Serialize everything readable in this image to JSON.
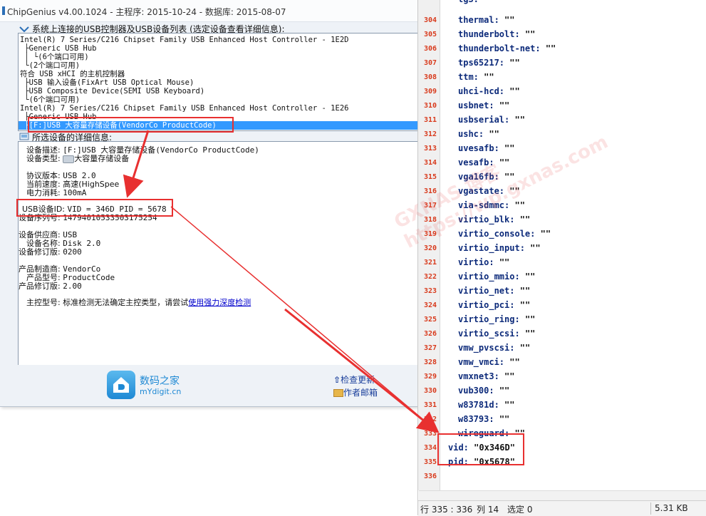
{
  "chipgenius": {
    "title": "ChipGenius v4.00.1024 - 主程序: 2015-10-24 - 数据库: 2015-08-07",
    "device_list_header": "系统上连接的USB控制器及USB设备列表 (选定设备查看详细信息):",
    "tree": [
      "Intel(R) 7 Series/C216 Chipset Family USB Enhanced Host Controller - 1E2D",
      " ├Generic USB Hub",
      " │ └(6个端口可用)",
      " └(2个端口可用)",
      "符合 USB xHCI 的主机控制器",
      " ├USB 输入设备(FixArt USB Optical Mouse)",
      " ├USB Composite Device(SEMI USB Keyboard)",
      " └(6个端口可用)",
      "Intel(R) 7 Series/C216 Chipset Family USB Enhanced Host Controller - 1E26",
      " ├Generic USB Hub",
      " ├[F:]USB 大容量存储设备(VendorCo ProductCode)"
    ],
    "detail_header": "所选设备的详细信息:",
    "details": {
      "desc_label": "设备描述:",
      "desc_value": "[F:]USB 大容量存储设备(VendorCo ProductCode)",
      "type_label": "设备类型:",
      "type_value": "大容量存储设备",
      "proto_label": "协议版本:",
      "proto_value": "USB 2.0",
      "speed_label": "当前速度:",
      "speed_value": "高速(HighSpee",
      "power_label": "电力消耗:",
      "power_value": "100mA",
      "id_label": "USB设备ID:",
      "id_value": "VID = 346D PID = 5678",
      "serial_label": "设备序列号:",
      "serial_value": "14794010533503175254",
      "vendor_label": "设备供应商:",
      "vendor_value": "USB",
      "name_label": "设备名称:",
      "name_value": "Disk 2.0",
      "rev_label": "设备修订版:",
      "rev_value": "0200",
      "mfr_label": "产品制造商:",
      "mfr_value": "VendorCo",
      "model_label": "产品型号:",
      "model_value": "ProductCode",
      "prev_label": "产品修订版:",
      "prev_value": "2.00",
      "ctrl_label": "主控型号:",
      "ctrl_value": "标准检测无法确定主控类型，请尝试",
      "ctrl_link": "使用强力深度检测"
    },
    "footer": {
      "logo_cn": "数码之家",
      "logo_en": "mYdigit.cn",
      "check_update": "检查更新",
      "author_email": "作者邮箱"
    }
  },
  "editor": {
    "lines": [
      {
        "n": "",
        "key": "tg3:",
        "val": ""
      },
      {
        "n": "304",
        "key": "thermal:",
        "val": "\"\""
      },
      {
        "n": "305",
        "key": "thunderbolt:",
        "val": "\"\""
      },
      {
        "n": "306",
        "key": "thunderbolt-net:",
        "val": "\"\""
      },
      {
        "n": "307",
        "key": "tps65217:",
        "val": "\"\""
      },
      {
        "n": "308",
        "key": "ttm:",
        "val": "\"\""
      },
      {
        "n": "309",
        "key": "uhci-hcd:",
        "val": "\"\""
      },
      {
        "n": "310",
        "key": "usbnet:",
        "val": "\"\""
      },
      {
        "n": "311",
        "key": "usbserial:",
        "val": "\"\""
      },
      {
        "n": "312",
        "key": "ushc:",
        "val": "\"\""
      },
      {
        "n": "313",
        "key": "uvesafb:",
        "val": "\"\""
      },
      {
        "n": "314",
        "key": "vesafb:",
        "val": "\"\""
      },
      {
        "n": "315",
        "key": "vga16fb:",
        "val": "\"\""
      },
      {
        "n": "316",
        "key": "vgastate:",
        "val": "\"\""
      },
      {
        "n": "317",
        "key": "via-sdmmc:",
        "val": "\"\""
      },
      {
        "n": "318",
        "key": "virtio_blk:",
        "val": "\"\""
      },
      {
        "n": "319",
        "key": "virtio_console:",
        "val": "\"\""
      },
      {
        "n": "320",
        "key": "virtio_input:",
        "val": "\"\""
      },
      {
        "n": "321",
        "key": "virtio:",
        "val": "\"\""
      },
      {
        "n": "322",
        "key": "virtio_mmio:",
        "val": "\"\""
      },
      {
        "n": "323",
        "key": "virtio_net:",
        "val": "\"\""
      },
      {
        "n": "324",
        "key": "virtio_pci:",
        "val": "\"\""
      },
      {
        "n": "325",
        "key": "virtio_ring:",
        "val": "\"\""
      },
      {
        "n": "326",
        "key": "virtio_scsi:",
        "val": "\"\""
      },
      {
        "n": "327",
        "key": "vmw_pvscsi:",
        "val": "\"\""
      },
      {
        "n": "328",
        "key": "vmw_vmci:",
        "val": "\"\""
      },
      {
        "n": "329",
        "key": "vmxnet3:",
        "val": "\"\""
      },
      {
        "n": "330",
        "key": "vub300:",
        "val": "\"\""
      },
      {
        "n": "331",
        "key": "w83781d:",
        "val": "\"\""
      },
      {
        "n": "332",
        "key": "w83793:",
        "val": "\"\""
      },
      {
        "n": "333",
        "key": "wireguard:",
        "val": "\"\""
      },
      {
        "n": "334",
        "key": "vid:",
        "val": "\"0x346D\""
      },
      {
        "n": "335",
        "key": "pid:",
        "val": "\"0x5678\""
      },
      {
        "n": "336",
        "key": "",
        "val": ""
      }
    ],
    "status": {
      "position": "行 335 : 336",
      "column": "列 14",
      "selection": "选定 0",
      "size": "5.31 KB"
    }
  },
  "watermark": {
    "line1": "GXNAS 博客",
    "line2": "https://wp.gxnas.com"
  },
  "colors": {
    "annotation_red": "#e83030",
    "selection_blue": "#3399ff",
    "line_number_red": "#d83a1c",
    "code_key_navy": "#0c2a7a"
  }
}
